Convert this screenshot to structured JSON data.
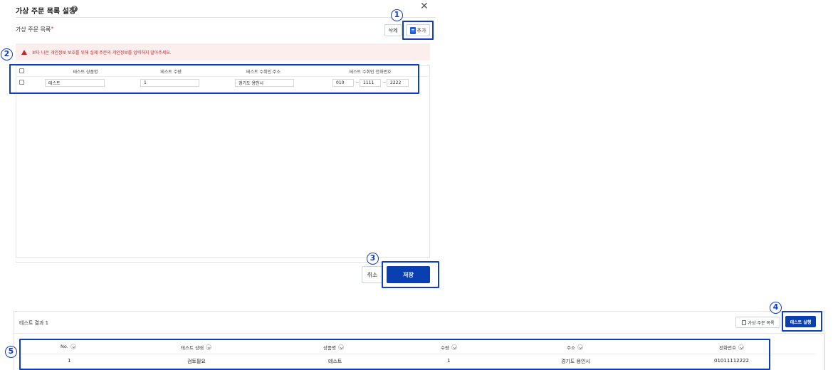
{
  "dialog": {
    "title": "가상 주문 목록 설정",
    "list_label": "가상 주문 목록",
    "required_mark": "*",
    "delete_label": "삭제",
    "add_label": "추가",
    "warning": "보다 나은 개인정보 보호를 위해 실제 주문의 개인정보를 입력하지 말아주세요.",
    "table": {
      "columns": [
        "테스트 상품명",
        "테스트 수량",
        "테스트 수취인 주소",
        "테스트 수취인 전화번호"
      ],
      "rows": [
        {
          "product": "테스트",
          "qty": "1",
          "address": "경기도 용인시",
          "phone1": "010",
          "phone2": "1111",
          "phone3": "2222"
        }
      ]
    },
    "cancel_label": "취소",
    "save_label": "저장"
  },
  "results": {
    "title": "테스트 결과 1",
    "list_button": "가상 주문 목록",
    "run_button": "테스트 실행",
    "columns": [
      "No.",
      "테스트 상태",
      "상품명",
      "수량",
      "주소",
      "전화번호"
    ],
    "rows": [
      {
        "no": "1",
        "status": "검토필요",
        "product": "테스트",
        "qty": "1",
        "address": "경기도 용인시",
        "phone": "01011112222"
      }
    ]
  },
  "annotations": [
    "1",
    "2",
    "3",
    "4",
    "5"
  ],
  "colors": {
    "accent": "#0a3fb2",
    "highlight": "#0f3ec0",
    "warning": "#c0262d",
    "warning_bg": "#fdeeee"
  }
}
